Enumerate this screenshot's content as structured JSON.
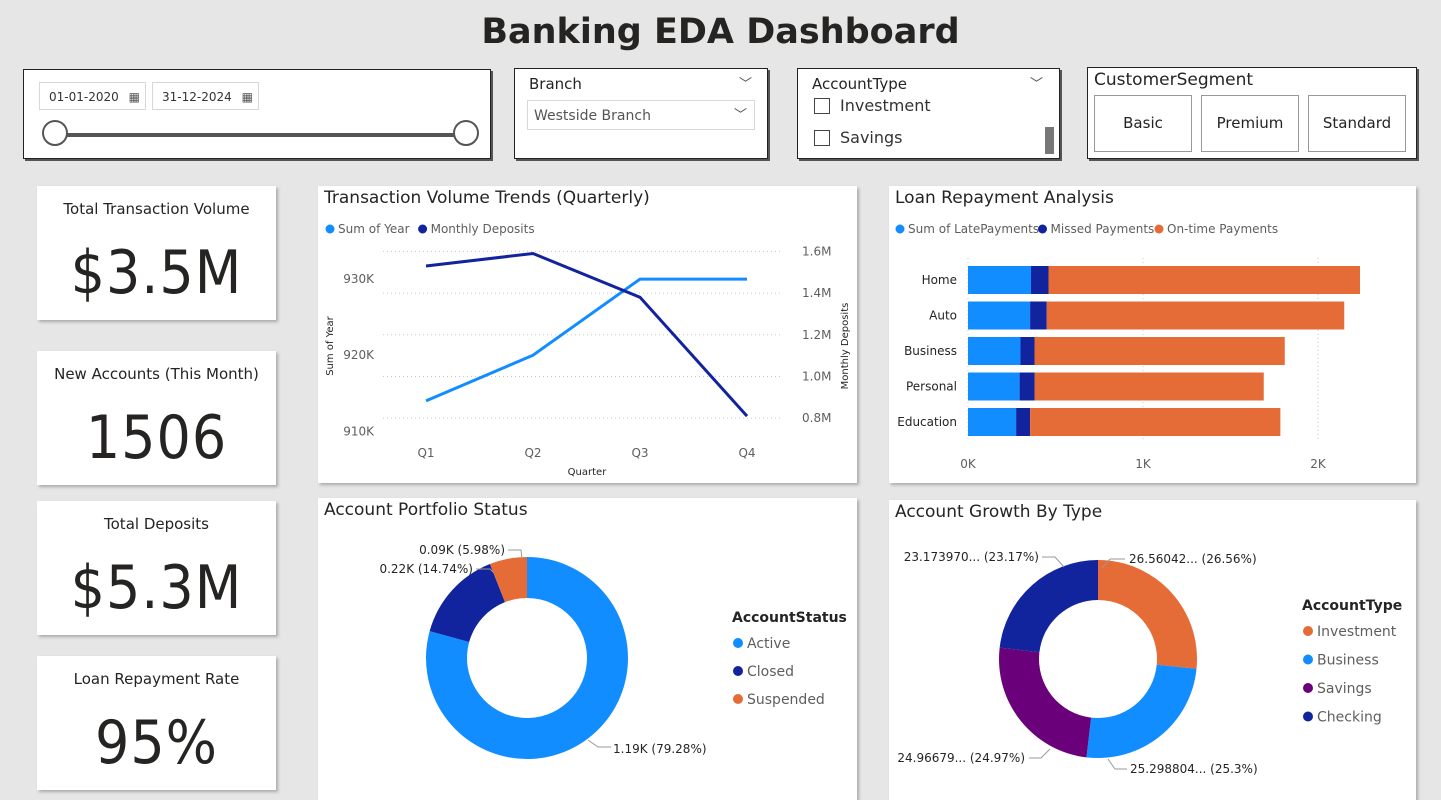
{
  "page": {
    "title": "Banking EDA Dashboard"
  },
  "date_slicer": {
    "start": "01-01-2020",
    "end": "31-12-2024"
  },
  "branch_slicer": {
    "title": "Branch",
    "selected": "Westside Branch"
  },
  "accounttype_slicer": {
    "title": "AccountType",
    "options": [
      "Investment",
      "Savings"
    ]
  },
  "segment_slicer": {
    "title": "CustomerSegment",
    "options": [
      "Basic",
      "Premium",
      "Standard"
    ]
  },
  "kpis": [
    {
      "label": "Total Transaction Volume",
      "value": "$3.5M"
    },
    {
      "label": "New Accounts (This Month)",
      "value": "1506"
    },
    {
      "label": "Total Deposits",
      "value": "$5.3M"
    },
    {
      "label": "Loan Repayment Rate",
      "value": "95%"
    }
  ],
  "colors": {
    "light_blue": "#118dff",
    "dark_blue": "#12239e",
    "orange": "#e66c37",
    "purple": "#6b007b"
  },
  "chart_data": [
    {
      "type": "line",
      "title": "Transaction Volume Trends (Quarterly)",
      "xlabel": "Quarter",
      "ylabel": "Sum of Year",
      "y2label": "Monthly Deposits",
      "categories": [
        "Q1",
        "Q2",
        "Q3",
        "Q4"
      ],
      "series": [
        {
          "name": "Sum of Year",
          "axis": "left",
          "color": "#118dff",
          "values": [
            914000,
            920000,
            930000,
            930000
          ]
        },
        {
          "name": "Monthly Deposits",
          "axis": "right",
          "color": "#12239e",
          "values": [
            1530000,
            1590000,
            1380000,
            810000
          ]
        }
      ],
      "ylim": [
        909000,
        935000
      ],
      "y2lim": [
        0.8,
        1.6
      ],
      "y_ticks": [
        {
          "v": 910000,
          "label": "910K"
        },
        {
          "v": 920000,
          "label": "920K"
        },
        {
          "v": 930000,
          "label": "930K"
        }
      ],
      "y2_ticks": [
        {
          "v": 800000,
          "label": "0.8M"
        },
        {
          "v": 1000000,
          "label": "1.0M"
        },
        {
          "v": 1200000,
          "label": "1.2M"
        },
        {
          "v": 1400000,
          "label": "1.4M"
        },
        {
          "v": 1600000,
          "label": "1.6M"
        }
      ],
      "legend_position": "top-left",
      "grid": true
    },
    {
      "type": "bar",
      "orientation": "horizontal-stacked",
      "title": "Loan Repayment Analysis",
      "categories": [
        "Home",
        "Auto",
        "Business",
        "Personal",
        "Education"
      ],
      "series": [
        {
          "name": "Sum of LatePayments",
          "color": "#118dff",
          "values": [
            360,
            355,
            300,
            295,
            275
          ]
        },
        {
          "name": "Missed Payments",
          "color": "#12239e",
          "values": [
            100,
            95,
            80,
            85,
            80
          ]
        },
        {
          "name": "On-time Payments",
          "color": "#e66c37",
          "values": [
            1780,
            1700,
            1430,
            1310,
            1430
          ]
        }
      ],
      "xlim": [
        0,
        2300
      ],
      "x_ticks": [
        {
          "v": 0,
          "label": "0K"
        },
        {
          "v": 1000,
          "label": "1K"
        },
        {
          "v": 2000,
          "label": "2K"
        }
      ],
      "legend_position": "top-left",
      "grid": true
    },
    {
      "type": "pie",
      "variant": "donut",
      "title": "Account Portfolio Status",
      "legend_title": "AccountStatus",
      "slices": [
        {
          "name": "Active",
          "value": 79.28,
          "label": "1.19K (79.28%)",
          "color": "#118dff"
        },
        {
          "name": "Closed",
          "value": 14.74,
          "label": "0.22K (14.74%)",
          "color": "#12239e"
        },
        {
          "name": "Suspended",
          "value": 5.98,
          "label": "0.09K (5.98%)",
          "color": "#e66c37"
        }
      ],
      "legend_position": "right"
    },
    {
      "type": "pie",
      "variant": "donut",
      "title": "Account Growth By Type",
      "legend_title": "AccountType",
      "slices": [
        {
          "name": "Investment",
          "value": 26.56,
          "label": "26.56042... (26.56%)",
          "color": "#e66c37"
        },
        {
          "name": "Business",
          "value": 25.3,
          "label": "25.298804... (25.3%)",
          "color": "#118dff"
        },
        {
          "name": "Savings",
          "value": 24.97,
          "label": "24.96679... (24.97%)",
          "color": "#6b007b"
        },
        {
          "name": "Checking",
          "value": 23.17,
          "label": "23.173970... (23.17%)",
          "color": "#12239e"
        }
      ],
      "legend_position": "right"
    }
  ]
}
